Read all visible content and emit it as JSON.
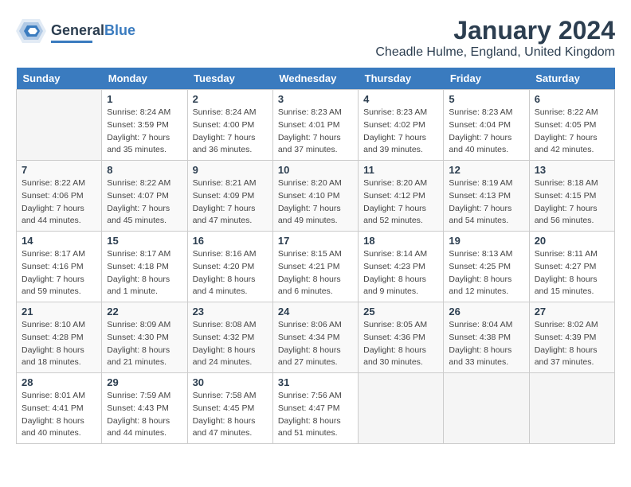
{
  "header": {
    "logo_general": "General",
    "logo_blue": "Blue",
    "title": "January 2024",
    "subtitle": "Cheadle Hulme, England, United Kingdom"
  },
  "calendar": {
    "days_of_week": [
      "Sunday",
      "Monday",
      "Tuesday",
      "Wednesday",
      "Thursday",
      "Friday",
      "Saturday"
    ],
    "weeks": [
      [
        {
          "day": "",
          "info": ""
        },
        {
          "day": "1",
          "info": "Sunrise: 8:24 AM\nSunset: 3:59 PM\nDaylight: 7 hours\nand 35 minutes."
        },
        {
          "day": "2",
          "info": "Sunrise: 8:24 AM\nSunset: 4:00 PM\nDaylight: 7 hours\nand 36 minutes."
        },
        {
          "day": "3",
          "info": "Sunrise: 8:23 AM\nSunset: 4:01 PM\nDaylight: 7 hours\nand 37 minutes."
        },
        {
          "day": "4",
          "info": "Sunrise: 8:23 AM\nSunset: 4:02 PM\nDaylight: 7 hours\nand 39 minutes."
        },
        {
          "day": "5",
          "info": "Sunrise: 8:23 AM\nSunset: 4:04 PM\nDaylight: 7 hours\nand 40 minutes."
        },
        {
          "day": "6",
          "info": "Sunrise: 8:22 AM\nSunset: 4:05 PM\nDaylight: 7 hours\nand 42 minutes."
        }
      ],
      [
        {
          "day": "7",
          "info": "Sunrise: 8:22 AM\nSunset: 4:06 PM\nDaylight: 7 hours\nand 44 minutes."
        },
        {
          "day": "8",
          "info": "Sunrise: 8:22 AM\nSunset: 4:07 PM\nDaylight: 7 hours\nand 45 minutes."
        },
        {
          "day": "9",
          "info": "Sunrise: 8:21 AM\nSunset: 4:09 PM\nDaylight: 7 hours\nand 47 minutes."
        },
        {
          "day": "10",
          "info": "Sunrise: 8:20 AM\nSunset: 4:10 PM\nDaylight: 7 hours\nand 49 minutes."
        },
        {
          "day": "11",
          "info": "Sunrise: 8:20 AM\nSunset: 4:12 PM\nDaylight: 7 hours\nand 52 minutes."
        },
        {
          "day": "12",
          "info": "Sunrise: 8:19 AM\nSunset: 4:13 PM\nDaylight: 7 hours\nand 54 minutes."
        },
        {
          "day": "13",
          "info": "Sunrise: 8:18 AM\nSunset: 4:15 PM\nDaylight: 7 hours\nand 56 minutes."
        }
      ],
      [
        {
          "day": "14",
          "info": "Sunrise: 8:17 AM\nSunset: 4:16 PM\nDaylight: 7 hours\nand 59 minutes."
        },
        {
          "day": "15",
          "info": "Sunrise: 8:17 AM\nSunset: 4:18 PM\nDaylight: 8 hours\nand 1 minute."
        },
        {
          "day": "16",
          "info": "Sunrise: 8:16 AM\nSunset: 4:20 PM\nDaylight: 8 hours\nand 4 minutes."
        },
        {
          "day": "17",
          "info": "Sunrise: 8:15 AM\nSunset: 4:21 PM\nDaylight: 8 hours\nand 6 minutes."
        },
        {
          "day": "18",
          "info": "Sunrise: 8:14 AM\nSunset: 4:23 PM\nDaylight: 8 hours\nand 9 minutes."
        },
        {
          "day": "19",
          "info": "Sunrise: 8:13 AM\nSunset: 4:25 PM\nDaylight: 8 hours\nand 12 minutes."
        },
        {
          "day": "20",
          "info": "Sunrise: 8:11 AM\nSunset: 4:27 PM\nDaylight: 8 hours\nand 15 minutes."
        }
      ],
      [
        {
          "day": "21",
          "info": "Sunrise: 8:10 AM\nSunset: 4:28 PM\nDaylight: 8 hours\nand 18 minutes."
        },
        {
          "day": "22",
          "info": "Sunrise: 8:09 AM\nSunset: 4:30 PM\nDaylight: 8 hours\nand 21 minutes."
        },
        {
          "day": "23",
          "info": "Sunrise: 8:08 AM\nSunset: 4:32 PM\nDaylight: 8 hours\nand 24 minutes."
        },
        {
          "day": "24",
          "info": "Sunrise: 8:06 AM\nSunset: 4:34 PM\nDaylight: 8 hours\nand 27 minutes."
        },
        {
          "day": "25",
          "info": "Sunrise: 8:05 AM\nSunset: 4:36 PM\nDaylight: 8 hours\nand 30 minutes."
        },
        {
          "day": "26",
          "info": "Sunrise: 8:04 AM\nSunset: 4:38 PM\nDaylight: 8 hours\nand 33 minutes."
        },
        {
          "day": "27",
          "info": "Sunrise: 8:02 AM\nSunset: 4:39 PM\nDaylight: 8 hours\nand 37 minutes."
        }
      ],
      [
        {
          "day": "28",
          "info": "Sunrise: 8:01 AM\nSunset: 4:41 PM\nDaylight: 8 hours\nand 40 minutes."
        },
        {
          "day": "29",
          "info": "Sunrise: 7:59 AM\nSunset: 4:43 PM\nDaylight: 8 hours\nand 44 minutes."
        },
        {
          "day": "30",
          "info": "Sunrise: 7:58 AM\nSunset: 4:45 PM\nDaylight: 8 hours\nand 47 minutes."
        },
        {
          "day": "31",
          "info": "Sunrise: 7:56 AM\nSunset: 4:47 PM\nDaylight: 8 hours\nand 51 minutes."
        },
        {
          "day": "",
          "info": ""
        },
        {
          "day": "",
          "info": ""
        },
        {
          "day": "",
          "info": ""
        }
      ]
    ]
  }
}
